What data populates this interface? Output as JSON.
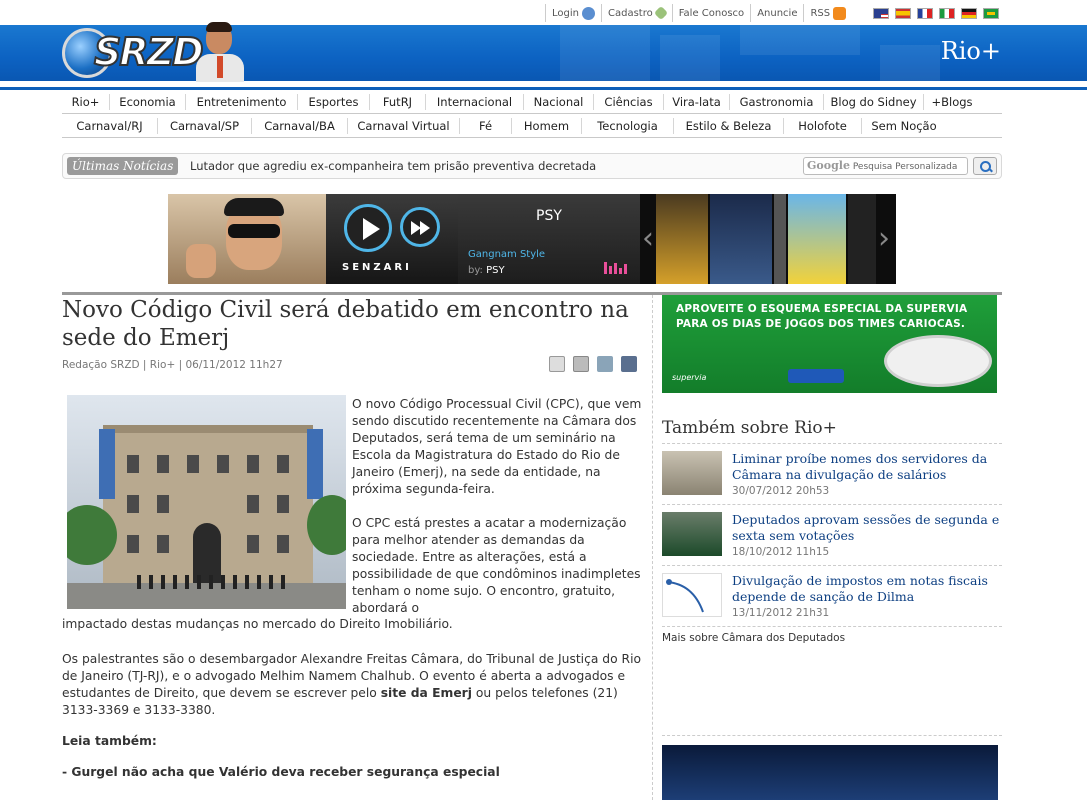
{
  "utility_links": {
    "login": "Login",
    "signup": "Cadastro",
    "contact": "Fale Conosco",
    "advertise": "Anuncie",
    "rss": "RSS"
  },
  "flags": [
    "us-flag",
    "es-flag",
    "fr-flag",
    "it-flag",
    "de-flag",
    "br-flag"
  ],
  "header": {
    "logo_text": "SRZD",
    "section": "Rio+"
  },
  "nav_row1": [
    "Rio+",
    "Economia",
    "Entretenimento",
    "Esportes",
    "FutRJ",
    "Internacional",
    "Nacional",
    "Ciências",
    "Vira-lata",
    "Gastronomia",
    "Blog do Sidney",
    "+Blogs"
  ],
  "nav_row2": [
    "Carnaval/RJ",
    "Carnaval/SP",
    "Carnaval/BA",
    "Carnaval Virtual",
    "Fé",
    "Homem",
    "Tecnologia",
    "Estilo & Beleza",
    "Holofote",
    "Sem Noção"
  ],
  "latest": {
    "label": "Últimas Notícias",
    "headline": "Lutador que agrediu ex-companheira tem prisão preventiva decretada",
    "search_brand": "Google",
    "search_placeholder": "Pesquisa Personalizada"
  },
  "player_ad": {
    "brand": "SENZARI",
    "artist": "PSY",
    "song": "Gangnam Style",
    "by_label": "by:",
    "by_value": "PSY"
  },
  "article": {
    "title": "Novo Código Civil será debatido em encontro na sede do Emerj",
    "meta": "Redação SRZD | Rio+ | 06/11/2012 11h27",
    "p1": "O novo Código Processual Civil (CPC), que vem sendo discutido recentemente na Câmara dos Deputados, será tema de um seminário na Escola da Magistratura do Estado do Rio de Janeiro (Emerj), na sede da entidade, na próxima segunda-feira.",
    "p2": "O CPC está prestes a acatar a modernização para melhor atender as demandas da sociedade. Entre as alterações, está a possibilidade de que condôminos inadimpletes tenham o nome sujo. O encontro, gratuito, abordará o",
    "p2b": "impactado destas mudanças no mercado do Direito Imobiliário.",
    "p3_a": "Os palestrantes são o desembargador Alexandre Freitas Câmara, do Tribunal de Justiça do Rio de Janeiro (TJ-RJ), e o advogado Melhim Namem Chalhub. O evento é aberta a advogados e estudantes de Direito, que devem se escrever pelo ",
    "p3_link": "site da Emerj",
    "p3_b": " ou pelos telefones (21) 3133-3369 e 3133-3380.",
    "read_also": "Leia também:",
    "related": "- Gurgel não acha que Valério deva receber segurança especial"
  },
  "sidebar": {
    "ad_line1": "APROVEITE O ESQUEMA ESPECIAL DA SUPERVIA",
    "ad_line2": "PARA OS DIAS DE JOGOS DOS TIMES CARIOCAS.",
    "ad_brand": "supervia",
    "heading": "Também sobre Rio+",
    "items": [
      {
        "title": "Liminar proíbe nomes dos servidores da Câmara na divulgação de salários",
        "date": "30/07/2012 20h53"
      },
      {
        "title": "Deputados aprovam sessões de segunda e sexta sem votações",
        "date": "18/10/2012 11h15"
      },
      {
        "title": "Divulgação de impostos em notas fiscais depende de sanção de Dilma",
        "date": "13/11/2012 21h31"
      }
    ],
    "more": "Mais sobre Câmara dos Deputados"
  },
  "colors": {
    "banner_blue": "#0c62c2",
    "link_blue": "#0d3f82",
    "ad_green": "#1f9f3a"
  }
}
